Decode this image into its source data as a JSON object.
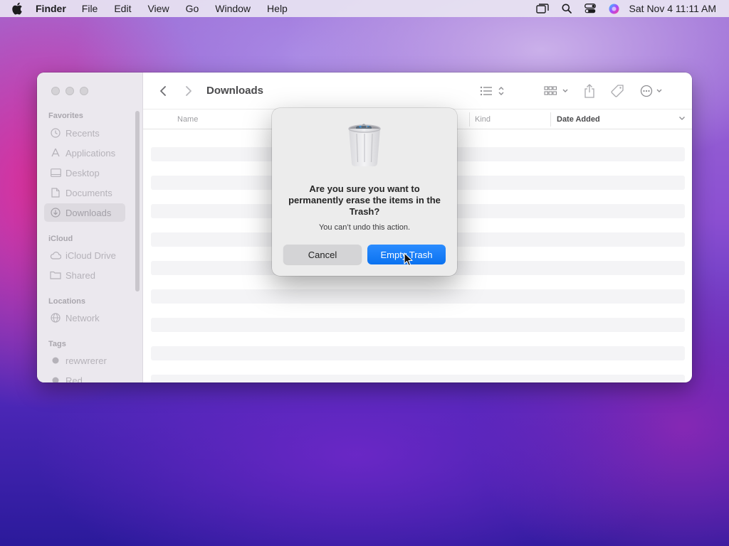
{
  "menubar": {
    "app_name": "Finder",
    "menus": [
      "File",
      "Edit",
      "View",
      "Go",
      "Window",
      "Help"
    ],
    "datetime": "Sat Nov 4  11:11 AM"
  },
  "window": {
    "title": "Downloads",
    "sidebar": {
      "favorites_header": "Favorites",
      "favorites": [
        "Recents",
        "Applications",
        "Desktop",
        "Documents",
        "Downloads"
      ],
      "selected": "Downloads",
      "icloud_header": "iCloud",
      "icloud": [
        "iCloud Drive",
        "Shared"
      ],
      "locations_header": "Locations",
      "locations": [
        "Network"
      ],
      "tags_header": "Tags",
      "tags": [
        "rewwrerer",
        "Red"
      ]
    },
    "columns": {
      "name": "Name",
      "kind": "Kind",
      "date_added": "Date Added"
    }
  },
  "alert": {
    "title": "Are you sure you want to permanently erase the items in the Trash?",
    "message": "You can’t undo this action.",
    "cancel_label": "Cancel",
    "confirm_label": "Empty Trash"
  },
  "colors": {
    "accent": "#0a72f0",
    "sidebar_bg": "#ebe8ee",
    "alert_bg": "#ececec"
  }
}
